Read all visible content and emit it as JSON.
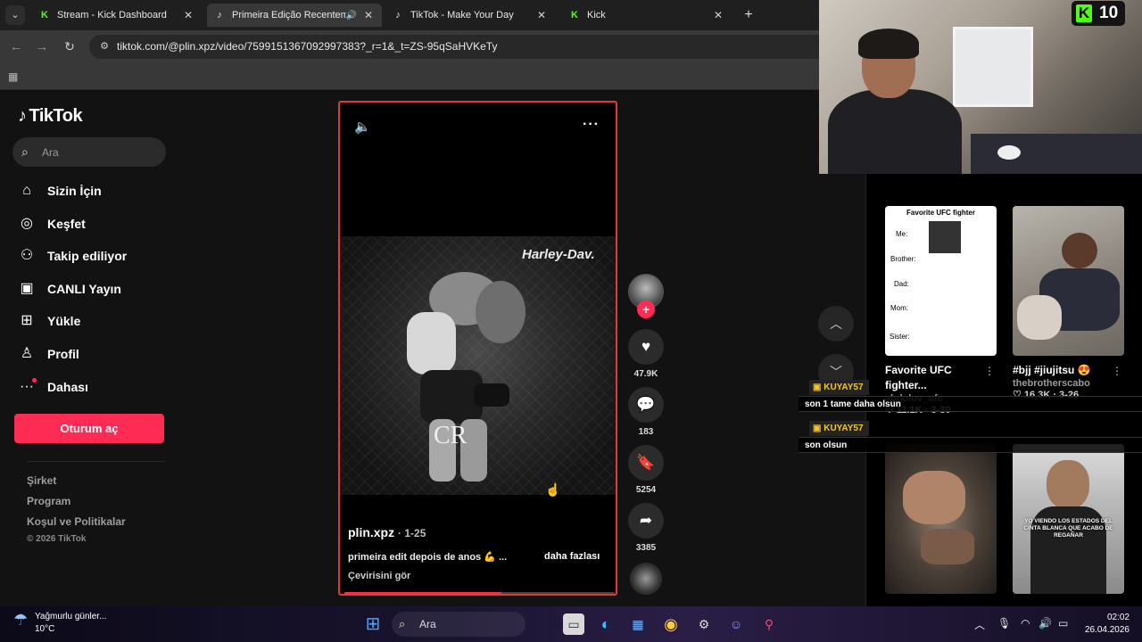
{
  "browser": {
    "tabs": [
      {
        "title": "Stream - Kick Dashboard",
        "favicon": "kick-icon"
      },
      {
        "title": "Primeira Edição Recenteme",
        "favicon": "tiktok-icon",
        "active": true
      },
      {
        "title": "TikTok - Make Your Day",
        "favicon": "tiktok-icon"
      },
      {
        "title": "Kick",
        "favicon": "kick-icon"
      }
    ],
    "url": "tiktok.com/@plin.xpz/video/7599151367092997383?_r=1&_t=ZS-95qSaHVKeTy"
  },
  "tiktok": {
    "logo": "TikTok",
    "search_placeholder": "Ara",
    "nav": [
      {
        "label": "Sizin İçin",
        "icon": "home-icon"
      },
      {
        "label": "Keşfet",
        "icon": "compass-icon"
      },
      {
        "label": "Takip ediliyor",
        "icon": "following-icon"
      },
      {
        "label": "CANLI Yayın",
        "icon": "live-icon"
      },
      {
        "label": "Yükle",
        "icon": "upload-icon"
      },
      {
        "label": "Profil",
        "icon": "profile-icon"
      },
      {
        "label": "Dahası",
        "icon": "more-icon"
      }
    ],
    "login_button": "Oturum aç",
    "footer_links": [
      "Şirket",
      "Program",
      "Koşul ve Politikalar"
    ],
    "copyright": "© 2026 TikTok"
  },
  "video": {
    "author": "plin.xpz",
    "date": "· 1-25",
    "caption": "primeira edit depois de anos 💪 ...",
    "more_label": "daha fazlası",
    "translate_label": "Çevirisini gör",
    "sign_text": "Harley-Dav.",
    "progress": 0.58,
    "likes": "47.9K",
    "comments": "183",
    "saves": "5254",
    "shares": "3385"
  },
  "stream": {
    "kick_viewers": "10"
  },
  "recommendations": [
    {
      "title_line1": "Favorite UFC",
      "title_line2": "fighter...",
      "user": "abdulov_ufc",
      "meta": "♡ 11.1K · 3-30",
      "thumb_heading": "Favorite UFC fighter",
      "thumb_rows": [
        "Me:",
        "Brother:",
        "Dad:",
        "Mom:",
        "Sister:"
      ]
    },
    {
      "title_line1": "#bjj #jiujitsu 😍",
      "user": "thebrotherscabo",
      "meta": "♡ 16.3K · 3-26"
    },
    {
      "title_line1": ""
    },
    {
      "title_line1": "",
      "thumb_text": "YO VIENDO LOS ESTADOS DEL CINTA BLANCA QUE ACABO DE REGAÑAR"
    }
  ],
  "chat": [
    {
      "user": "KUYAY57",
      "message": "son 1 tame daha olsun"
    },
    {
      "user": "KUYAY57",
      "message": "son olsun"
    }
  ],
  "taskbar": {
    "weather_line1": "Yağmurlu günler...",
    "weather_line2": "10°C",
    "search_label": "Ara",
    "time": "02:02",
    "date": "26.04.2026"
  },
  "colors": {
    "tiktok_red": "#fe2c55",
    "kick_green": "#53fc18",
    "chat_username": "#f4c434"
  }
}
